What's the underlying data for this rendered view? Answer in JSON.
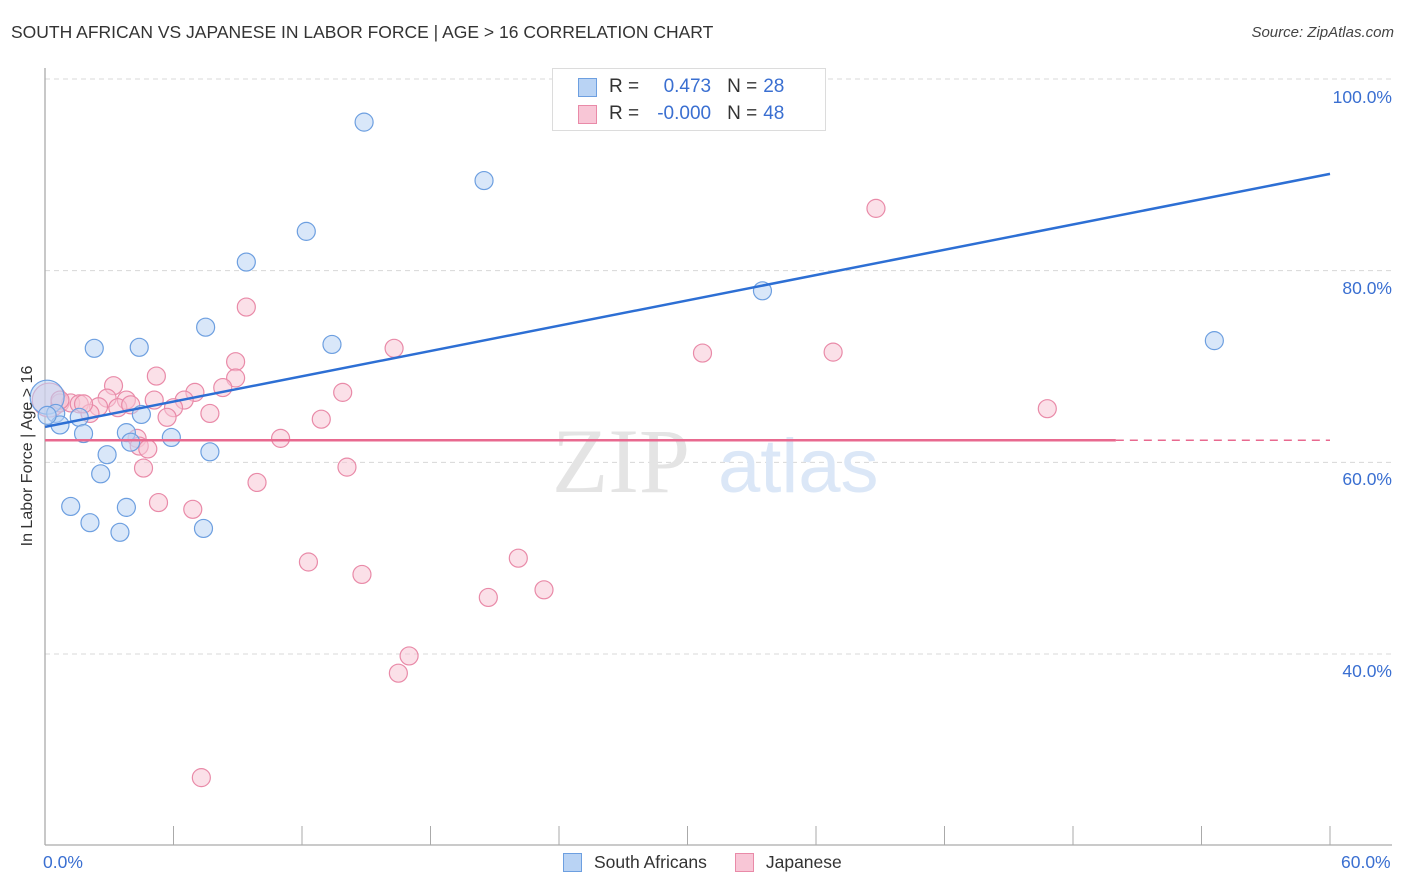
{
  "title": "SOUTH AFRICAN VS JAPANESE IN LABOR FORCE | AGE > 16 CORRELATION CHART",
  "source": "Source: ZipAtlas.com",
  "watermark": {
    "zip": "ZIP",
    "atlas": "atlas"
  },
  "colors": {
    "blue_fill": "#b9d3f4",
    "blue_stroke": "#6d9fe0",
    "blue_line": "#2d6fd4",
    "pink_fill": "#f8c6d6",
    "pink_stroke": "#e98aa8",
    "pink_line": "#e8698f",
    "tick_text": "#3a6fd1",
    "grid": "#d8d8d8"
  },
  "legend": {
    "rows": [
      {
        "r_label": "R =",
        "r_value": "0.473",
        "n_label": "N =",
        "n_value": "28"
      },
      {
        "r_label": "R =",
        "r_value": "-0.000",
        "n_label": "N =",
        "n_value": "48"
      }
    ]
  },
  "chart_data": {
    "type": "scatter",
    "title": "SOUTH AFRICAN VS JAPANESE IN LABOR FORCE | AGE > 16 CORRELATION CHART",
    "xlabel": "",
    "ylabel": "In Labor Force | Age > 16",
    "xlim": [
      0,
      60
    ],
    "ylim": [
      22,
      102
    ],
    "x_tick_labels": [
      "0.0%",
      "60.0%"
    ],
    "y_ticks": [
      100,
      80,
      60,
      40
    ],
    "y_tick_labels": [
      "100.0%",
      "80.0%",
      "60.0%",
      "40.0%"
    ],
    "grid": true,
    "legend_position": "top-center",
    "series": [
      {
        "name": "South Africans",
        "r": 0.473,
        "n": 28,
        "trend": {
          "x0": 0,
          "y0": 63.7,
          "x1": 60,
          "y1": 90.1,
          "dashed_from": null
        },
        "points": [
          [
            14.9,
            95.5
          ],
          [
            20.5,
            89.4
          ],
          [
            12.2,
            84.1
          ],
          [
            9.4,
            80.9
          ],
          [
            33.5,
            77.9
          ],
          [
            7.5,
            74.1
          ],
          [
            2.3,
            71.9
          ],
          [
            4.4,
            72.0
          ],
          [
            13.4,
            72.3
          ],
          [
            54.6,
            72.7
          ],
          [
            0.1,
            66.8
          ],
          [
            0.5,
            65.1
          ],
          [
            0.7,
            63.9
          ],
          [
            1.6,
            64.7
          ],
          [
            4.5,
            65.0
          ],
          [
            1.8,
            63.0
          ],
          [
            3.8,
            63.1
          ],
          [
            4.0,
            62.1
          ],
          [
            5.9,
            62.6
          ],
          [
            2.9,
            60.8
          ],
          [
            7.7,
            61.1
          ],
          [
            2.6,
            58.8
          ],
          [
            1.2,
            55.4
          ],
          [
            3.8,
            55.3
          ],
          [
            2.1,
            53.7
          ],
          [
            3.5,
            52.7
          ],
          [
            7.4,
            53.1
          ],
          [
            0.1,
            64.9
          ]
        ]
      },
      {
        "name": "Japanese",
        "r": -0.0,
        "n": 48,
        "trend": {
          "x0": 0,
          "y0": 62.3,
          "x1": 60,
          "y1": 62.3,
          "dashed_from": 50
        },
        "points": [
          [
            38.8,
            86.5
          ],
          [
            9.4,
            76.2
          ],
          [
            16.3,
            71.9
          ],
          [
            30.7,
            71.4
          ],
          [
            36.8,
            71.5
          ],
          [
            8.9,
            70.5
          ],
          [
            5.2,
            69.0
          ],
          [
            8.9,
            68.8
          ],
          [
            3.2,
            68.0
          ],
          [
            7.0,
            67.3
          ],
          [
            13.9,
            67.3
          ],
          [
            8.3,
            67.8
          ],
          [
            2.9,
            66.7
          ],
          [
            3.8,
            66.5
          ],
          [
            5.1,
            66.5
          ],
          [
            6.5,
            66.5
          ],
          [
            0.2,
            66.5
          ],
          [
            0.7,
            66.2
          ],
          [
            1.2,
            66.2
          ],
          [
            1.6,
            66.1
          ],
          [
            2.5,
            65.8
          ],
          [
            3.4,
            65.7
          ],
          [
            6.0,
            65.7
          ],
          [
            2.1,
            65.1
          ],
          [
            5.7,
            64.7
          ],
          [
            7.7,
            65.1
          ],
          [
            12.9,
            64.5
          ],
          [
            46.8,
            65.6
          ],
          [
            11.0,
            62.5
          ],
          [
            4.3,
            62.5
          ],
          [
            4.4,
            61.7
          ],
          [
            4.8,
            61.4
          ],
          [
            4.6,
            59.4
          ],
          [
            14.1,
            59.5
          ],
          [
            9.9,
            57.9
          ],
          [
            5.3,
            55.8
          ],
          [
            6.9,
            55.1
          ],
          [
            22.1,
            50.0
          ],
          [
            12.3,
            49.6
          ],
          [
            14.8,
            48.3
          ],
          [
            23.3,
            46.7
          ],
          [
            20.7,
            45.9
          ],
          [
            17.0,
            39.8
          ],
          [
            16.5,
            38.0
          ],
          [
            7.3,
            27.1
          ],
          [
            1.8,
            66.1
          ],
          [
            4.0,
            66.0
          ],
          [
            0.7,
            66.5
          ]
        ]
      }
    ]
  }
}
